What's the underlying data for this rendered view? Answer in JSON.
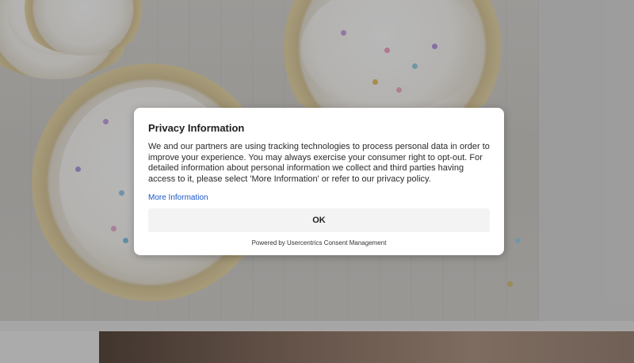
{
  "consent_dialog": {
    "title": "Privacy Information",
    "body": "We and our partners are using tracking technologies to process personal data in order to improve your experience. You may always exercise your consumer right to opt-out. For detailed information about personal information we collect and third parties having access to it, please select 'More Information' or refer to our privacy policy.",
    "more_information_label": "More Information",
    "ok_label": "OK",
    "powered_by": "Powered by Usercentrics Consent Management"
  },
  "colors": {
    "link": "#1a56c8",
    "button_bg": "#f3f3f3",
    "overlay": "rgba(0,0,0,0.28)"
  }
}
